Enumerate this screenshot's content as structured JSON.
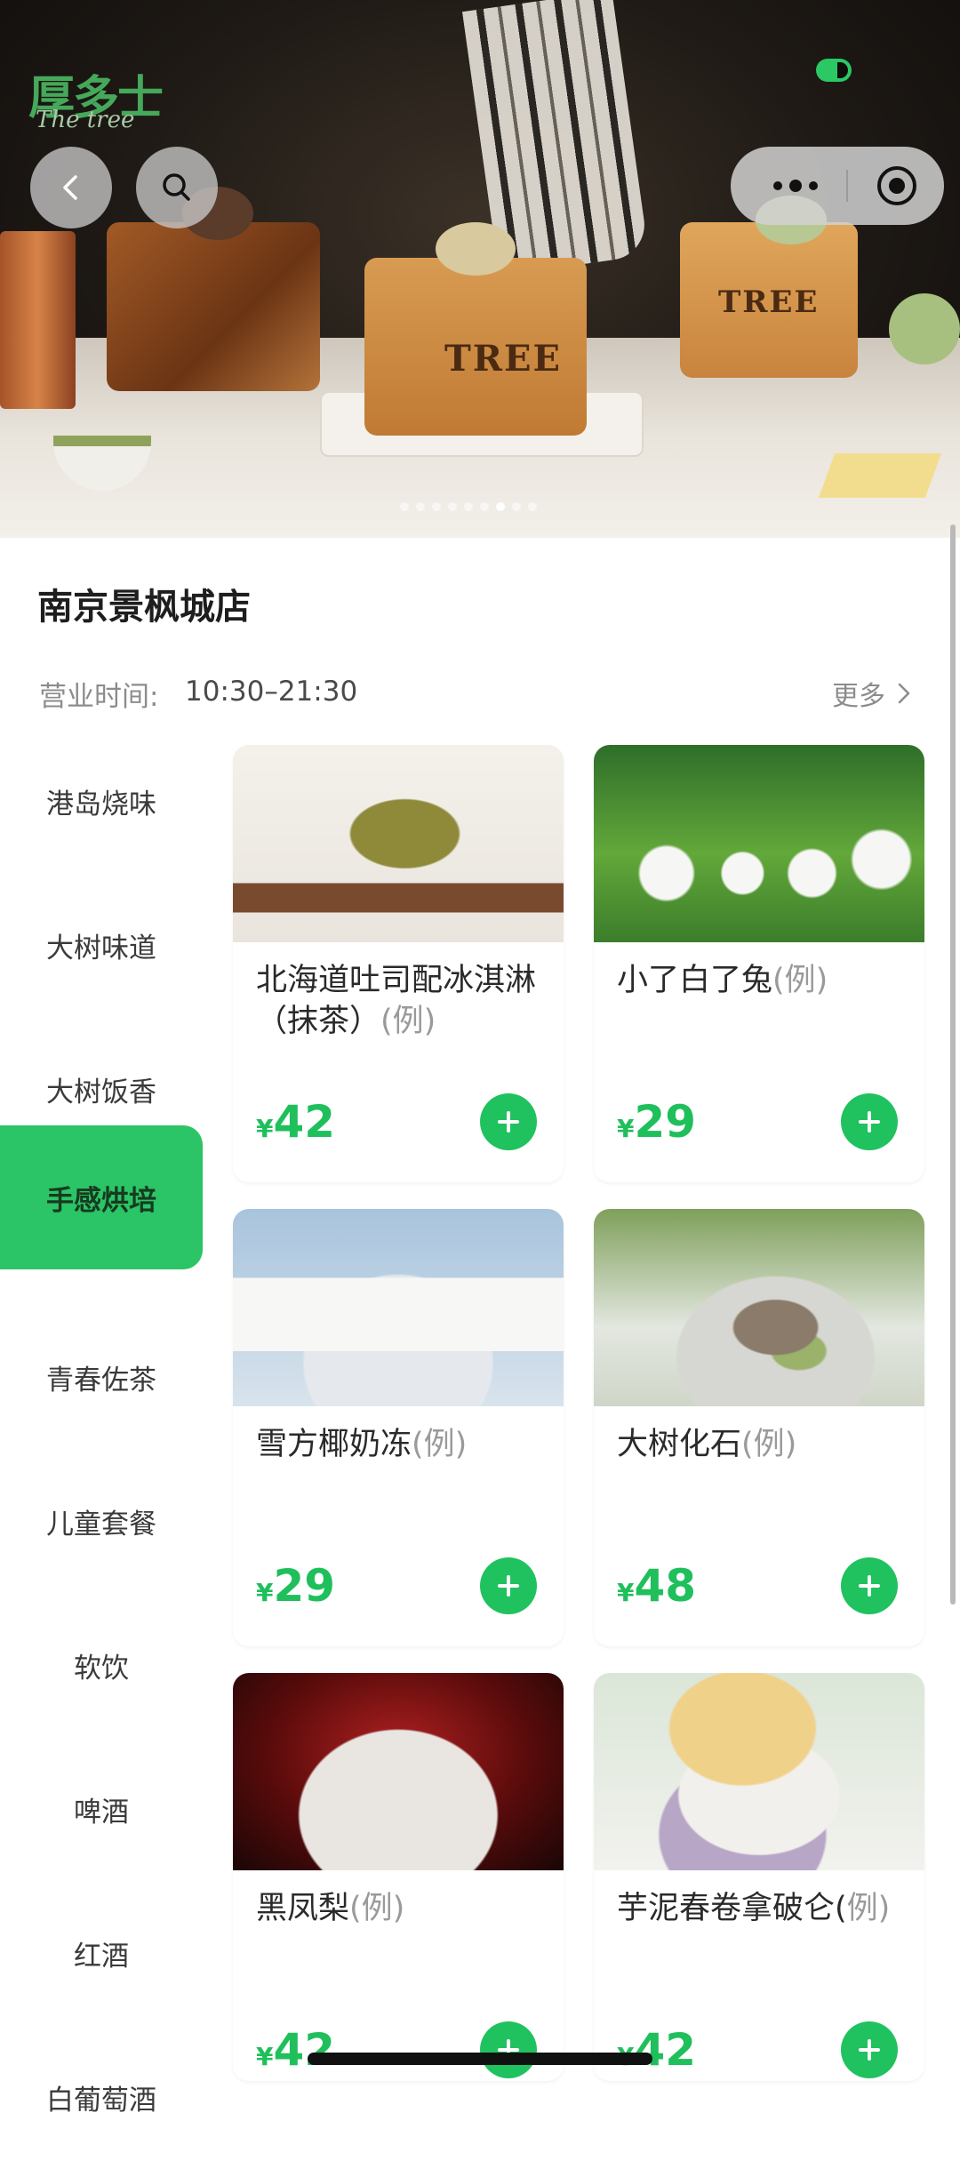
{
  "brand": {
    "logo_zh": "厚多士",
    "logo_en": "The tree"
  },
  "banner": {
    "dot_count": 9,
    "active_dot": 6
  },
  "store": {
    "name": "南京景枫城店",
    "hours_label": "营业时间:",
    "hours_value": "10:30–21:30",
    "more_label": "更多"
  },
  "categories": [
    {
      "label": "港岛烧味"
    },
    {
      "label": "大树味道"
    },
    {
      "label": "大树饭香"
    },
    {
      "label": "手感烘培",
      "active": true
    },
    {
      "label": "青春佐茶"
    },
    {
      "label": "儿童套餐"
    },
    {
      "label": "软饮"
    },
    {
      "label": "啤酒"
    },
    {
      "label": "红酒"
    },
    {
      "label": "白葡萄酒"
    }
  ],
  "products": [
    {
      "name": "北海道吐司配冰淇淋（抹茶）",
      "unit": "(例)",
      "currency": "¥",
      "price": "42"
    },
    {
      "name": "小了白了兔",
      "unit": "(例)",
      "currency": "¥",
      "price": "29"
    },
    {
      "name": "雪方椰奶冻",
      "unit": "(例)",
      "currency": "¥",
      "price": "29"
    },
    {
      "name": "大树化石",
      "unit": "(例)",
      "currency": "¥",
      "price": "48"
    },
    {
      "name": "黑凤梨",
      "unit": "(例)",
      "currency": "¥",
      "price": "42"
    },
    {
      "name": "芋泥春卷拿破仑(",
      "unit": "例)",
      "currency": "¥",
      "price": "42"
    }
  ],
  "colors": {
    "accent": "#1fc25e",
    "sidebar_active": "#2bc466",
    "text": "#2a2a2a",
    "muted": "#8c8c8c"
  }
}
